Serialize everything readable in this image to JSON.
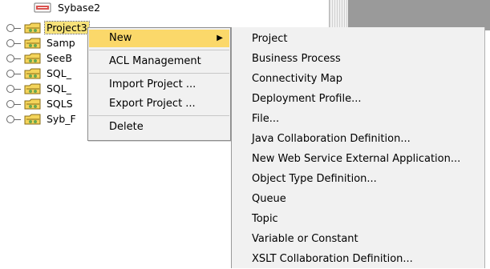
{
  "tree": {
    "top_item": {
      "label": "Sybase2",
      "icon": "database-icon"
    },
    "items": [
      {
        "label": "Project3",
        "selected": true
      },
      {
        "label": "Samp"
      },
      {
        "label": "SeeB"
      },
      {
        "label": "SQL_"
      },
      {
        "label": "SQL_"
      },
      {
        "label": "SQLS"
      },
      {
        "label": "Syb_F"
      }
    ]
  },
  "context_menu": {
    "items": [
      {
        "label": "New",
        "active": true,
        "has_submenu": true
      },
      {
        "label": "ACL Management"
      },
      {
        "label": "Import Project ..."
      },
      {
        "label": "Export Project ..."
      },
      {
        "label": "Delete"
      }
    ]
  },
  "submenu": {
    "items": [
      "Project",
      "Business Process",
      "Connectivity Map",
      "Deployment Profile...",
      "File...",
      "Java Collaboration Definition...",
      "New Web Service External Application...",
      "Object Type Definition...",
      "Queue",
      "Topic",
      "Variable or Constant",
      "XSLT Collaboration Definition..."
    ]
  },
  "colors": {
    "menu_background": "#f1f1f1",
    "highlight": "#fbd86a",
    "selection": "#f7e27a",
    "right_pane": "#9a9a9a"
  }
}
